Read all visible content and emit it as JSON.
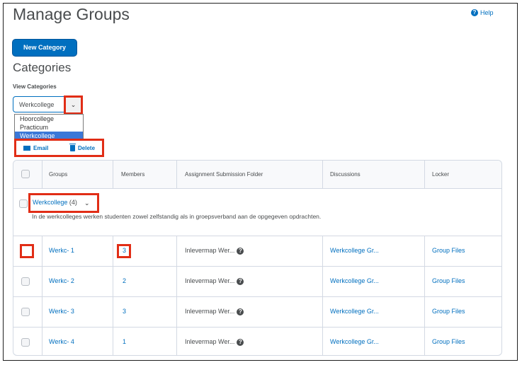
{
  "header": {
    "title": "Manage Groups",
    "help_label": "Help"
  },
  "toolbar": {
    "new_category_label": "New Category"
  },
  "categories_heading": "Categories",
  "view_categories": {
    "label": "View Categories",
    "selected": "Werkcollege",
    "options": [
      "Hoorcollege",
      "Practicum",
      "Werkcollege"
    ]
  },
  "actions": {
    "email_label": "Email",
    "delete_label": "Delete"
  },
  "table": {
    "columns": [
      "Groups",
      "Members",
      "Assignment Submission Folder",
      "Discussions",
      "Locker"
    ],
    "category": {
      "name": "Werkcollege",
      "count": "(4)",
      "description": "In de werkcolleges werken studenten zowel zelfstandig als in groepsverband aan de opgegeven opdrachten."
    },
    "rows": [
      {
        "group": "Werkc- 1",
        "members": "3",
        "folder": "Inlevermap Wer...",
        "discussion": "Werkcollege Gr...",
        "locker": "Group Files"
      },
      {
        "group": "Werkc- 2",
        "members": "2",
        "folder": "Inlevermap Wer...",
        "discussion": "Werkcollege Gr...",
        "locker": "Group Files"
      },
      {
        "group": "Werkc- 3",
        "members": "3",
        "folder": "Inlevermap Wer...",
        "discussion": "Werkcollege Gr...",
        "locker": "Group Files"
      },
      {
        "group": "Werkc- 4",
        "members": "1",
        "folder": "Inlevermap Wer...",
        "discussion": "Werkcollege Gr...",
        "locker": "Group Files"
      }
    ]
  },
  "colors": {
    "accent": "#006fbf",
    "highlight": "#e12d16"
  },
  "icons": {
    "help": "help-icon",
    "dropdown": "chevron-down-icon",
    "email": "mail-icon",
    "delete": "trash-icon",
    "folder_info": "question-icon"
  }
}
